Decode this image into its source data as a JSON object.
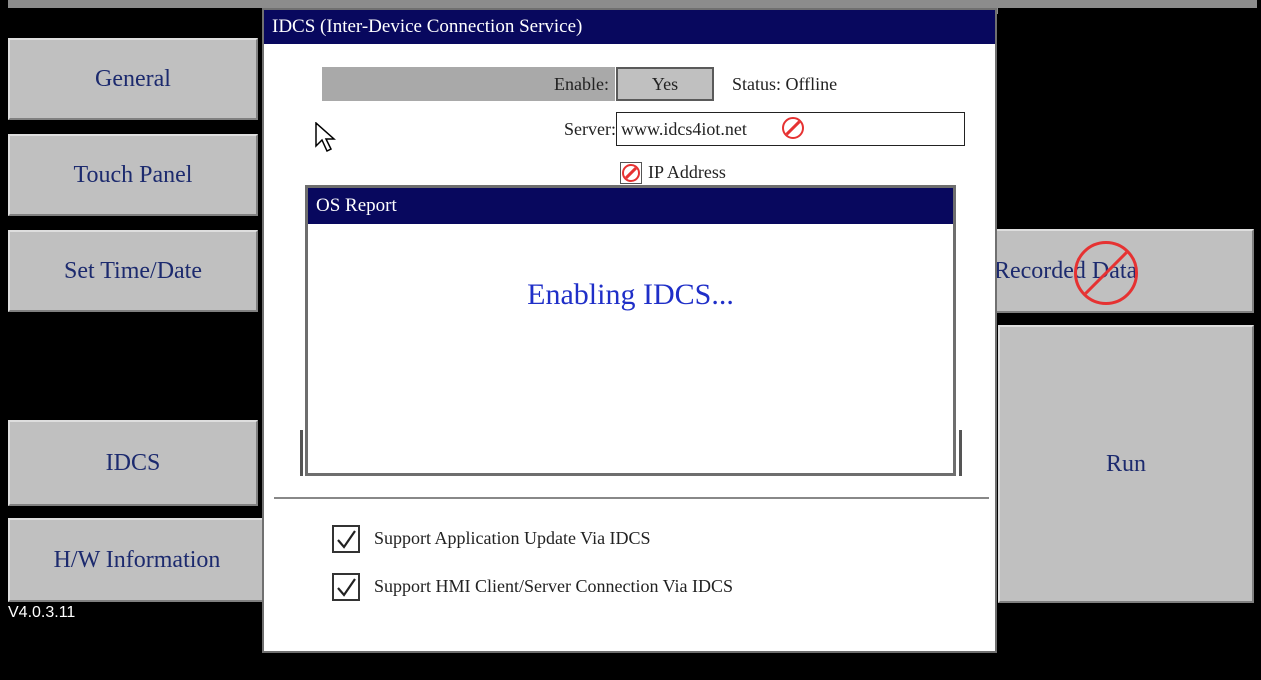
{
  "sidebar_left": {
    "buttons": [
      {
        "label": "General"
      },
      {
        "label": "Touch Panel"
      },
      {
        "label": "Set Time/Date"
      },
      {
        "label": "IDCS"
      },
      {
        "label": "H/W Information"
      }
    ]
  },
  "sidebar_right": {
    "buttons": [
      {
        "label": "Clear Recorded Data"
      },
      {
        "label": "Run"
      }
    ]
  },
  "version": "V4.0.3.11",
  "dialog": {
    "title": "IDCS (Inter-Device Connection Service)",
    "enable_label": "Enable:",
    "enable_value": "Yes",
    "status": "Status: Offline",
    "server_label": "Server:",
    "server_value": "www.idcs4iot.net",
    "ip_label": "IP Address",
    "options": [
      {
        "label": "Support Application Update Via IDCS",
        "checked": true
      },
      {
        "label": "Support HMI Client/Server Connection Via IDCS",
        "checked": true
      }
    ]
  },
  "os_report": {
    "title": "OS Report",
    "message": "Enabling IDCS..."
  },
  "colors": {
    "title_bar": "#08085e",
    "message_text": "#1f2fc8",
    "no_symbol": "#e63232"
  }
}
